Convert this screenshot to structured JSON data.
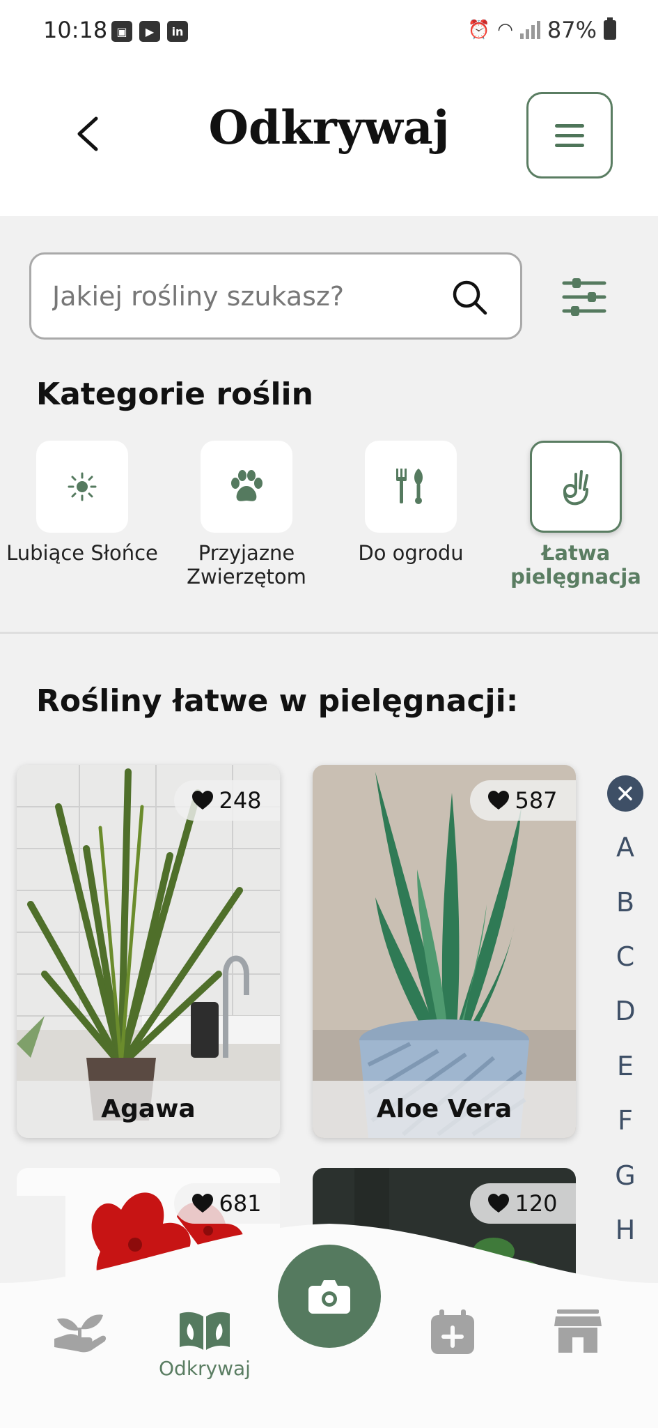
{
  "status_bar": {
    "time": "10:18",
    "battery": "87%"
  },
  "header": {
    "title": "Odkrywaj"
  },
  "search": {
    "placeholder": "Jakiej rośliny szukasz?"
  },
  "categories": {
    "title": "Kategorie roślin",
    "items": [
      {
        "label": "Lubiące Słońce",
        "icon": "sun-icon"
      },
      {
        "label": "Przyjazne Zwierzętom",
        "icon": "paw-icon"
      },
      {
        "label": "Do ogrodu",
        "icon": "garden-tools-icon"
      },
      {
        "label": "Łatwa pielęgnacja",
        "icon": "ok-hand-icon",
        "selected": true
      }
    ]
  },
  "plants": {
    "title": "Rośliny łatwe w pielęgnacji:",
    "items": [
      {
        "name": "Agawa",
        "likes": "248"
      },
      {
        "name": "Aloe Vera",
        "likes": "587"
      },
      {
        "name": "",
        "likes": "681"
      },
      {
        "name": "",
        "likes": "120"
      }
    ]
  },
  "alphabet": [
    "A",
    "B",
    "C",
    "D",
    "E",
    "F",
    "G",
    "H"
  ],
  "nav": {
    "items": [
      {
        "icon": "plant-hand-icon",
        "label": ""
      },
      {
        "icon": "open-book-icon",
        "label": "Odkrywaj"
      },
      {
        "icon": "camera-icon",
        "label": ""
      },
      {
        "icon": "calendar-plus-icon",
        "label": ""
      },
      {
        "icon": "store-icon",
        "label": ""
      }
    ]
  },
  "colors": {
    "accent": "#557a5f",
    "alphabet": "#3e4f66",
    "background": "#f1f1f1"
  }
}
